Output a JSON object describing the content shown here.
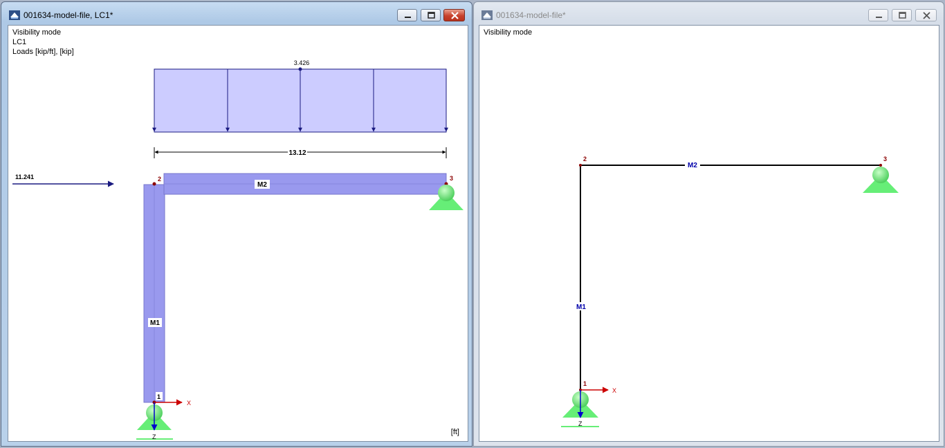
{
  "window_left": {
    "title": "001634-model-file, LC1*",
    "info": {
      "mode": "Visibility mode",
      "load_case": "LC1",
      "units": "Loads [kip/ft], [kip]"
    },
    "unit_label": "[ft]",
    "load_value": "3.426",
    "span_dimension": "13.12",
    "horizontal_load": "11.241",
    "members": {
      "m1": "M1",
      "m2": "M2"
    },
    "nodes": {
      "n1": "1",
      "n2": "2",
      "n3": "3"
    },
    "axes": {
      "x": "X",
      "z": "Z"
    },
    "icons": [
      "app-icon",
      "minimize-icon",
      "restore-icon",
      "close-icon"
    ]
  },
  "window_right": {
    "title": "001634-model-file*",
    "info": {
      "mode": "Visibility mode"
    },
    "members": {
      "m1": "M1",
      "m2": "M2"
    },
    "nodes": {
      "n1": "1",
      "n2": "2",
      "n3": "3"
    },
    "axes": {
      "x": "X",
      "z": "Z"
    },
    "icons": [
      "app-icon",
      "minimize-icon",
      "restore-icon",
      "close-icon"
    ]
  },
  "colors": {
    "member_fill": "#9999ee",
    "load_fill": "#ccccff",
    "load_line": "#1a1a80",
    "support_green": "#66ee77",
    "node_red": "#8b0000",
    "axis_x": "#cc0000",
    "axis_z": "#0000cc"
  }
}
